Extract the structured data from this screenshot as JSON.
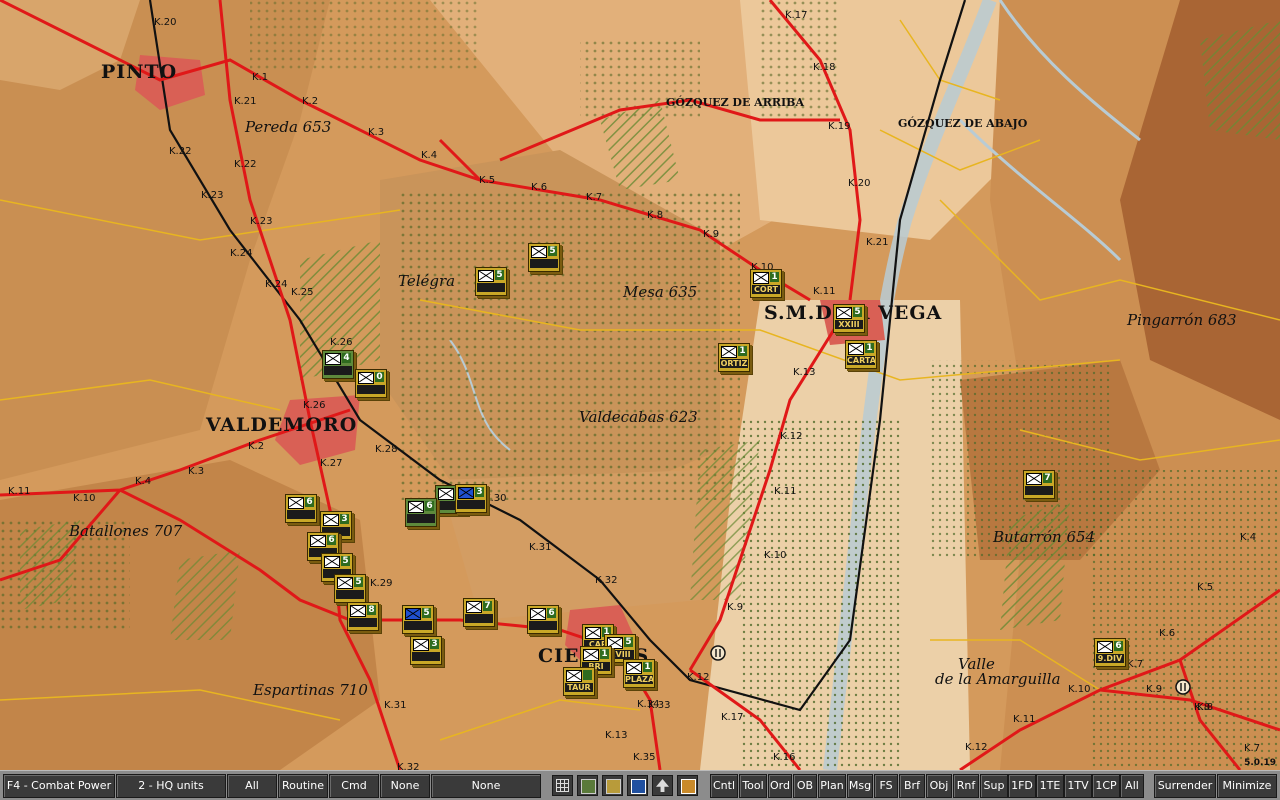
{
  "map": {
    "towns": [
      {
        "id": "pinto",
        "label": "PINTO"
      },
      {
        "id": "valdemoro",
        "label": "VALDEMORO"
      },
      {
        "id": "ciempozuelos",
        "label": "CIE       ELOS"
      },
      {
        "id": "smvega",
        "label": "S.M.D   LA VEGA"
      },
      {
        "id": "gozquez-arriba",
        "label": "GÓZQUEZ DE ARRIBA"
      },
      {
        "id": "gozquez-abajo",
        "label": "GÓZQUEZ DE ABAJO"
      }
    ],
    "hills": [
      {
        "id": "pereda",
        "label": "Pereda 653"
      },
      {
        "id": "telegrafo",
        "label": "Telégra"
      },
      {
        "id": "mesa",
        "label": "Mesa 635"
      },
      {
        "id": "valdecabas",
        "label": "Valdecabas 623"
      },
      {
        "id": "pingarron",
        "label": "Pingarrón 683"
      },
      {
        "id": "butarron",
        "label": "Butarrón 654"
      },
      {
        "id": "batallones",
        "label": "Batallones 707"
      },
      {
        "id": "espartinas",
        "label": "Espartinas 710"
      },
      {
        "id": "valle1",
        "label": "Valle"
      },
      {
        "id": "valle2",
        "label": "de la Amarguilla"
      }
    ],
    "km_markers": [
      "K.20",
      "K.1",
      "K.21",
      "K.2",
      "K.3",
      "K.4",
      "K.22",
      "K.22",
      "K.23",
      "K.23",
      "K.24",
      "K.24",
      "K.25",
      "K.26",
      "K.26",
      "K.27",
      "K.28",
      "K.2",
      "K.3",
      "K.4",
      "K.10",
      "K.11",
      "K.5",
      "K.6",
      "K.7",
      "K.8",
      "K.9",
      "K.10",
      "K.11",
      "K.12",
      "K.13",
      "K.17",
      "K.18",
      "K.19",
      "K.20",
      "K.21",
      "K.30",
      "K.31",
      "K.32",
      "K.9",
      "K.10",
      "K.11",
      "K.12",
      "K.13",
      "K.16",
      "K.17",
      "K.33",
      "K.34",
      "K.35",
      "K.31",
      "K.32",
      "K.29",
      "K.4",
      "K.5",
      "K.6",
      "K.7",
      "K.8",
      "K.9",
      "K.10",
      "K.11",
      "K.12",
      "K.7",
      "K.8"
    ],
    "units": [
      {
        "id": "u1",
        "val": "5",
        "name": "",
        "color": "yellow"
      },
      {
        "id": "u2",
        "val": "5",
        "name": "",
        "color": "yellow"
      },
      {
        "id": "u3",
        "val": "1",
        "name": "CORT",
        "color": "yellow"
      },
      {
        "id": "u4",
        "val": "5",
        "name": "XXIII",
        "color": "yellow"
      },
      {
        "id": "u5",
        "val": "1",
        "name": "CARTA",
        "color": "yellow"
      },
      {
        "id": "u6",
        "val": "1",
        "name": "ORTIZ",
        "color": "yellow"
      },
      {
        "id": "u7",
        "val": "4",
        "name": "",
        "color": "green"
      },
      {
        "id": "u8",
        "val": "0",
        "name": "",
        "color": "yellow"
      },
      {
        "id": "u9",
        "val": "3",
        "name": "",
        "color": "yellow"
      },
      {
        "id": "u10",
        "val": "6",
        "name": "",
        "color": "green"
      },
      {
        "id": "u11",
        "val": "6",
        "name": "",
        "color": "green"
      },
      {
        "id": "u12",
        "val": "3",
        "name": "",
        "color": "blue"
      },
      {
        "id": "u13",
        "val": "6",
        "name": "",
        "color": "yellow"
      },
      {
        "id": "u14",
        "val": "3",
        "name": "",
        "color": "yellow"
      },
      {
        "id": "u15",
        "val": "6",
        "name": "",
        "color": "yellow"
      },
      {
        "id": "u16",
        "val": "5",
        "name": "",
        "color": "yellow"
      },
      {
        "id": "u17",
        "val": "5",
        "name": "",
        "color": "yellow"
      },
      {
        "id": "u18",
        "val": "8",
        "name": "",
        "color": "yellow"
      },
      {
        "id": "u19",
        "val": "5",
        "name": "",
        "color": "blue"
      },
      {
        "id": "u20",
        "val": "3",
        "name": "",
        "color": "yellow"
      },
      {
        "id": "u21",
        "val": "7",
        "name": "",
        "color": "yellow"
      },
      {
        "id": "u22",
        "val": "6",
        "name": "",
        "color": "yellow"
      },
      {
        "id": "u23",
        "val": "1",
        "name": "CAR",
        "color": "yellow"
      },
      {
        "id": "u24",
        "val": "5",
        "name": "XVIII",
        "color": "yellow"
      },
      {
        "id": "u25",
        "val": "1",
        "name": "BRI",
        "color": "yellow"
      },
      {
        "id": "u26",
        "val": "1",
        "name": "PLAZA",
        "color": "yellow"
      },
      {
        "id": "u27",
        "val": "",
        "name": "TAUR",
        "color": "yellow"
      },
      {
        "id": "u28",
        "val": "7",
        "name": "",
        "color": "yellow"
      },
      {
        "id": "u29",
        "val": "6",
        "name": "9.DIV",
        "color": "yellow"
      }
    ],
    "version": "5.0.19"
  },
  "toolbar": {
    "buttons": [
      {
        "id": "combat-power",
        "label": "F4 - Combat Power"
      },
      {
        "id": "hq-units",
        "label": "2 - HQ units"
      },
      {
        "id": "all1",
        "label": "All"
      },
      {
        "id": "routine",
        "label": "Routine"
      },
      {
        "id": "cmd",
        "label": "Cmd"
      },
      {
        "id": "none1",
        "label": "None"
      },
      {
        "id": "none2",
        "label": "None"
      }
    ],
    "right_buttons": [
      {
        "id": "cntl",
        "label": "Cntl"
      },
      {
        "id": "tool",
        "label": "Tool"
      },
      {
        "id": "ord",
        "label": "Ord"
      },
      {
        "id": "ob",
        "label": "OB"
      },
      {
        "id": "plan",
        "label": "Plan"
      },
      {
        "id": "msg",
        "label": "Msg"
      },
      {
        "id": "fs",
        "label": "FS"
      },
      {
        "id": "brf",
        "label": "Brf"
      },
      {
        "id": "obj",
        "label": "Obj"
      },
      {
        "id": "rnf",
        "label": "Rnf"
      },
      {
        "id": "sup",
        "label": "Sup"
      },
      {
        "id": "1fd",
        "label": "1FD"
      },
      {
        "id": "1te",
        "label": "1TE"
      },
      {
        "id": "1tv",
        "label": "1TV"
      },
      {
        "id": "1cp",
        "label": "1CP"
      },
      {
        "id": "all2",
        "label": "All"
      },
      {
        "id": "surrender",
        "label": "Surrender"
      },
      {
        "id": "minimize",
        "label": "Minimize"
      }
    ],
    "icons": [
      "grid-icon",
      "terrain-icon",
      "units-icon",
      "upload-icon",
      "arrow-up-icon",
      "commander-icon"
    ]
  }
}
